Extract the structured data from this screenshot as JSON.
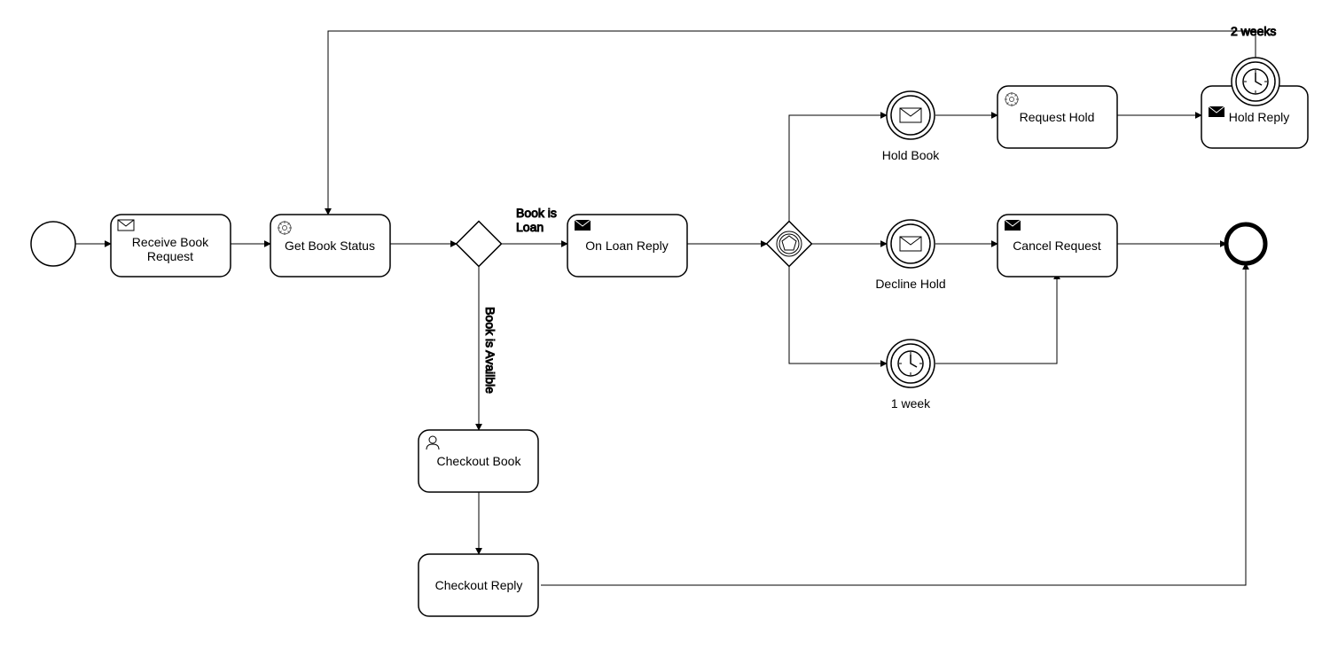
{
  "tasks": {
    "receive_book_request": "Receive Book\nRequest",
    "get_book_status": "Get Book Status",
    "on_loan_reply": "On Loan Reply",
    "request_hold": "Request Hold",
    "hold_reply": "Hold Reply",
    "cancel_request": "Cancel Request",
    "checkout_book": "Checkout Book",
    "checkout_reply": "Checkout Reply"
  },
  "events": {
    "hold_book": "Hold Book",
    "decline_hold": "Decline Hold",
    "one_week": "1 week",
    "two_weeks": "2 weeks"
  },
  "edges": {
    "book_is_loan": "Book is\nLoan",
    "book_is_available": "Book is Availble"
  }
}
